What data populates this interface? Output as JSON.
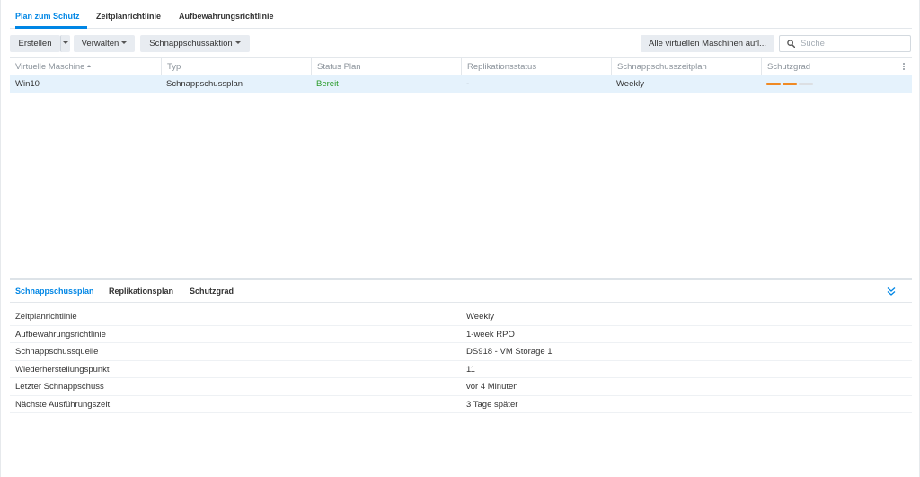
{
  "top_tabs": [
    {
      "label": "Plan zum Schutz",
      "active": true
    },
    {
      "label": "Zeitplanrichtlinie",
      "active": false
    },
    {
      "label": "Aufbewahrungsrichtlinie",
      "active": false
    }
  ],
  "toolbar": {
    "create_label": "Erstellen",
    "manage_label": "Verwalten",
    "snapshot_action_label": "Schnappschussaktion",
    "list_all_vms_label": "Alle virtuellen Maschinen aufl...",
    "search_placeholder": "Suche",
    "search_value": ""
  },
  "table": {
    "columns": [
      "Virtuelle Maschine",
      "Typ",
      "Status Plan",
      "Replikationsstatus",
      "Schnappschusszeitplan",
      "Schutzgrad"
    ],
    "sorted_column": "Virtuelle Maschine",
    "sort_direction": "ascending",
    "rows": [
      {
        "vm": "Win10",
        "type": "Schnappschussplan",
        "status": "Bereit",
        "replication": "-",
        "schedule": "Weekly",
        "protection_level": {
          "filled": 2,
          "total": 3
        }
      }
    ]
  },
  "bottom_tabs": [
    {
      "label": "Schnappschussplan",
      "active": true
    },
    {
      "label": "Replikationsplan",
      "active": false
    },
    {
      "label": "Schutzgrad",
      "active": false
    }
  ],
  "details": [
    {
      "label": "Zeitplanrichtlinie",
      "value": "Weekly"
    },
    {
      "label": "Aufbewahrungsrichtlinie",
      "value": "1-week RPO"
    },
    {
      "label": "Schnappschussquelle",
      "value": "DS918 - VM Storage 1"
    },
    {
      "label": "Wiederherstellungspunkt",
      "value": "11"
    },
    {
      "label": "Letzter Schnappschuss",
      "value": "vor 4 Minuten"
    },
    {
      "label": "Nächste Ausführungszeit",
      "value": "3 Tage später"
    }
  ],
  "colors": {
    "accent": "#0086e5",
    "status_ok": "#2a9b2a",
    "protection_filled": "#f08a24",
    "protection_empty": "#dcdfe3",
    "selected_row": "#e5f2fc"
  },
  "icons": {
    "search": "search-icon",
    "collapse": "double-chevron-down-icon",
    "column_menu": "vertical-ellipsis-icon"
  }
}
